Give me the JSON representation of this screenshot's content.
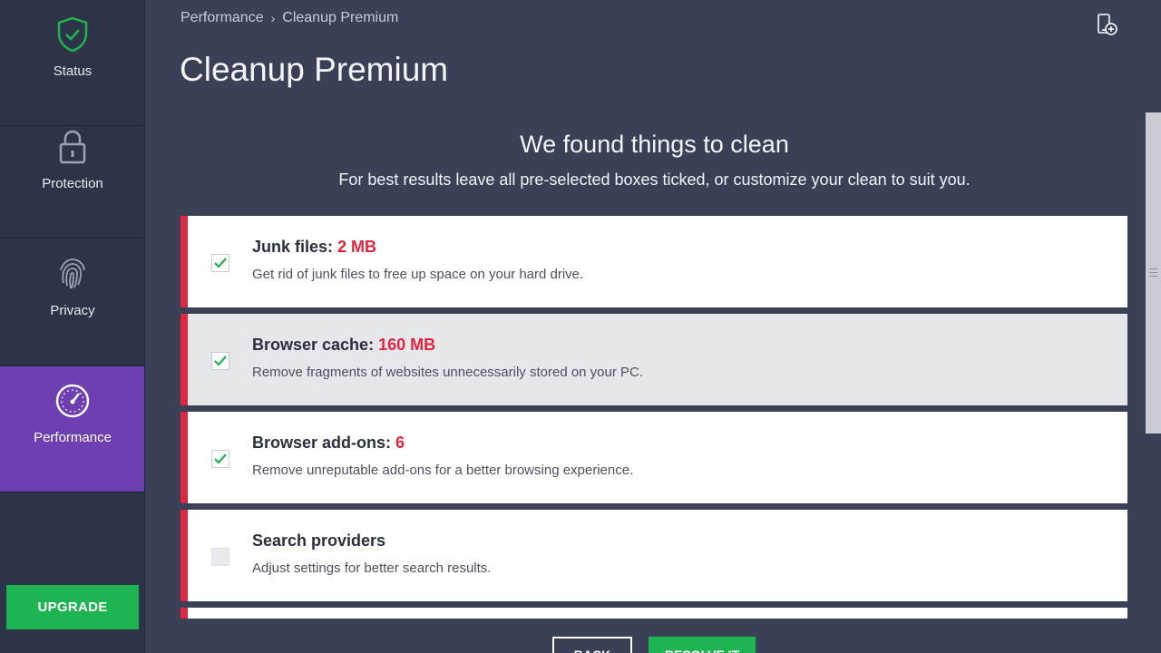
{
  "sidebar": {
    "items": [
      {
        "label": "Status",
        "icon": "shield-check-icon"
      },
      {
        "label": "Protection",
        "icon": "lock-icon"
      },
      {
        "label": "Privacy",
        "icon": "fingerprint-icon"
      },
      {
        "label": "Performance",
        "icon": "speedometer-icon",
        "active": true
      }
    ],
    "upgrade_label": "UPGRADE"
  },
  "header": {
    "breadcrumb": [
      "Performance",
      "Cleanup Premium"
    ],
    "title": "Cleanup Premium",
    "device_icon": "device-add-icon"
  },
  "main": {
    "heading": "We found things to clean",
    "subheading": "For best results leave all pre-selected boxes ticked, or customize your clean to suit you.",
    "items": [
      {
        "title": "Junk files:",
        "amount": "2 MB",
        "desc": "Get rid of junk files to free up space on your hard drive.",
        "checked": true
      },
      {
        "title": "Browser cache:",
        "amount": "160 MB",
        "desc": "Remove fragments of websites unnecessarily stored on your PC.",
        "checked": true
      },
      {
        "title": "Browser add-ons:",
        "amount": "6",
        "desc": "Remove unreputable add-ons for a better browsing experience.",
        "checked": true
      },
      {
        "title": "Search providers",
        "amount": "",
        "desc": "Adjust settings for better search results.",
        "checked": false
      }
    ],
    "back_label": "BACK",
    "resolve_label": "RESOLVE IT"
  },
  "colors": {
    "sidebar_bg": "#2d3447",
    "content_bg": "#3a4157",
    "accent_purple": "#6e3fb0",
    "green": "#1fb452",
    "red": "#e0253f"
  }
}
